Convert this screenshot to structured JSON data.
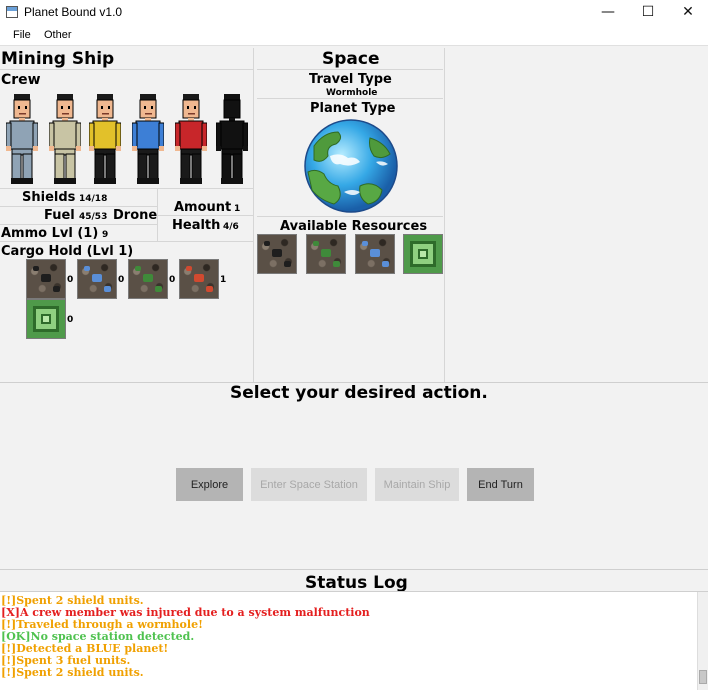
{
  "window": {
    "title": "Planet Bound v1.0",
    "minimize_glyph": "—",
    "maximize_glyph": "☐",
    "close_glyph": "✕"
  },
  "menu": {
    "items": [
      "File",
      "Other"
    ]
  },
  "ship": {
    "title": "Mining Ship",
    "crew_label": "Crew",
    "crew": [
      {
        "name": "crew-gray",
        "shirt": "#8fa3b5",
        "alive": true
      },
      {
        "name": "crew-beige",
        "shirt": "#c8c4a4",
        "alive": true
      },
      {
        "name": "crew-gold",
        "shirt": "#e2c12a",
        "alive": true
      },
      {
        "name": "crew-blue",
        "shirt": "#3d7fd6",
        "alive": true
      },
      {
        "name": "crew-red",
        "shirt": "#c8262a",
        "alive": true
      },
      {
        "name": "crew-silhouette",
        "shirt": "#111111",
        "alive": false
      }
    ],
    "shields_label": "Shields",
    "shields_value": "14/18",
    "fuel_label": "Fuel",
    "fuel_value": "45/53",
    "drone_label": "Drone",
    "amount_label": "Amount",
    "amount_value": "1",
    "health_label": "Health",
    "health_value": "4/6",
    "ammo_label": "Ammo Lvl (1)",
    "ammo_value": "9",
    "cargo_label": "Cargo Hold (Lvl 1)",
    "cargo": [
      {
        "resource": "black",
        "count": "0"
      },
      {
        "resource": "blue",
        "count": "0"
      },
      {
        "resource": "green",
        "count": "0"
      },
      {
        "resource": "red",
        "count": "1"
      },
      {
        "resource": "artifact",
        "count": "0"
      }
    ]
  },
  "space": {
    "title": "Space",
    "travel_type_label": "Travel Type",
    "travel_type_value": "Wormhole",
    "planet_type_label": "Planet Type",
    "planet_color": "blue",
    "resources_label": "Available Resources",
    "resources": [
      "black",
      "green",
      "blue",
      "artifact"
    ]
  },
  "action": {
    "prompt": "Select your desired action.",
    "buttons": [
      {
        "label": "Explore",
        "enabled": true
      },
      {
        "label": "Enter Space Station",
        "enabled": false
      },
      {
        "label": "Maintain Ship",
        "enabled": false
      },
      {
        "label": "End Turn",
        "enabled": true
      }
    ]
  },
  "log": {
    "title": "Status Log",
    "colors": {
      "warn": "#f0a000",
      "error": "#e41f1f",
      "ok": "#4fc24f"
    },
    "entries": [
      {
        "text": "[!]Spent 2 shield units.",
        "level": "warn"
      },
      {
        "text": "[X]A crew member was injured due to a system malfunction",
        "level": "error"
      },
      {
        "text": "[!]Traveled through a wormhole!",
        "level": "warn"
      },
      {
        "text": "[OK]No space station detected.",
        "level": "ok"
      },
      {
        "text": "[!]Detected a BLUE planet!",
        "level": "warn"
      },
      {
        "text": "[!]Spent 3 fuel units.",
        "level": "warn"
      },
      {
        "text": "[!]Spent 2 shield units.",
        "level": "warn"
      }
    ]
  }
}
